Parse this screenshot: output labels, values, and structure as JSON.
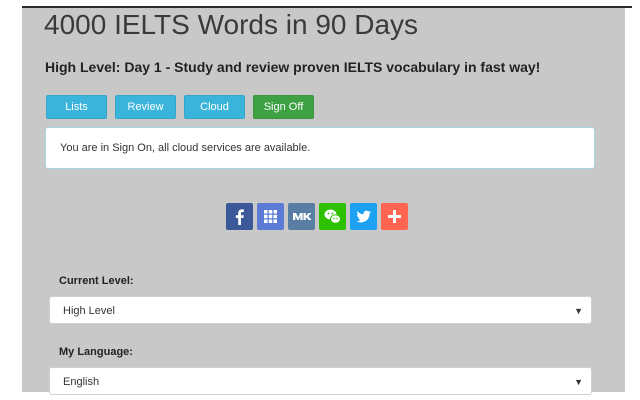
{
  "header": {
    "title": "4000 IELTS Words in 90 Days",
    "subtitle": "High Level: Day 1 - Study and review proven IELTS vocabulary in fast way!"
  },
  "nav": {
    "lists_label": "Lists",
    "review_label": "Review",
    "cloud_label": "Cloud",
    "signoff_label": "Sign Off"
  },
  "alert": {
    "message": "You are in Sign On, all cloud services are available."
  },
  "share": {
    "icons": [
      "facebook-icon",
      "grid-icon",
      "vk-icon",
      "wechat-icon",
      "twitter-icon",
      "plus-icon"
    ],
    "colors": {
      "facebook": "#3b5998",
      "grid": "#5b7bd5",
      "vk": "#587ea3",
      "wechat": "#2dc100",
      "twitter": "#1da1f2",
      "plus": "#ff6550"
    }
  },
  "form": {
    "current_level_label": "Current Level:",
    "current_level_value": "High Level",
    "language_label": "My Language:",
    "language_value": "English"
  },
  "colors": {
    "primary_button": "#3ab4da",
    "success_button": "#3ea244",
    "panel_background": "#c8c8c8"
  }
}
